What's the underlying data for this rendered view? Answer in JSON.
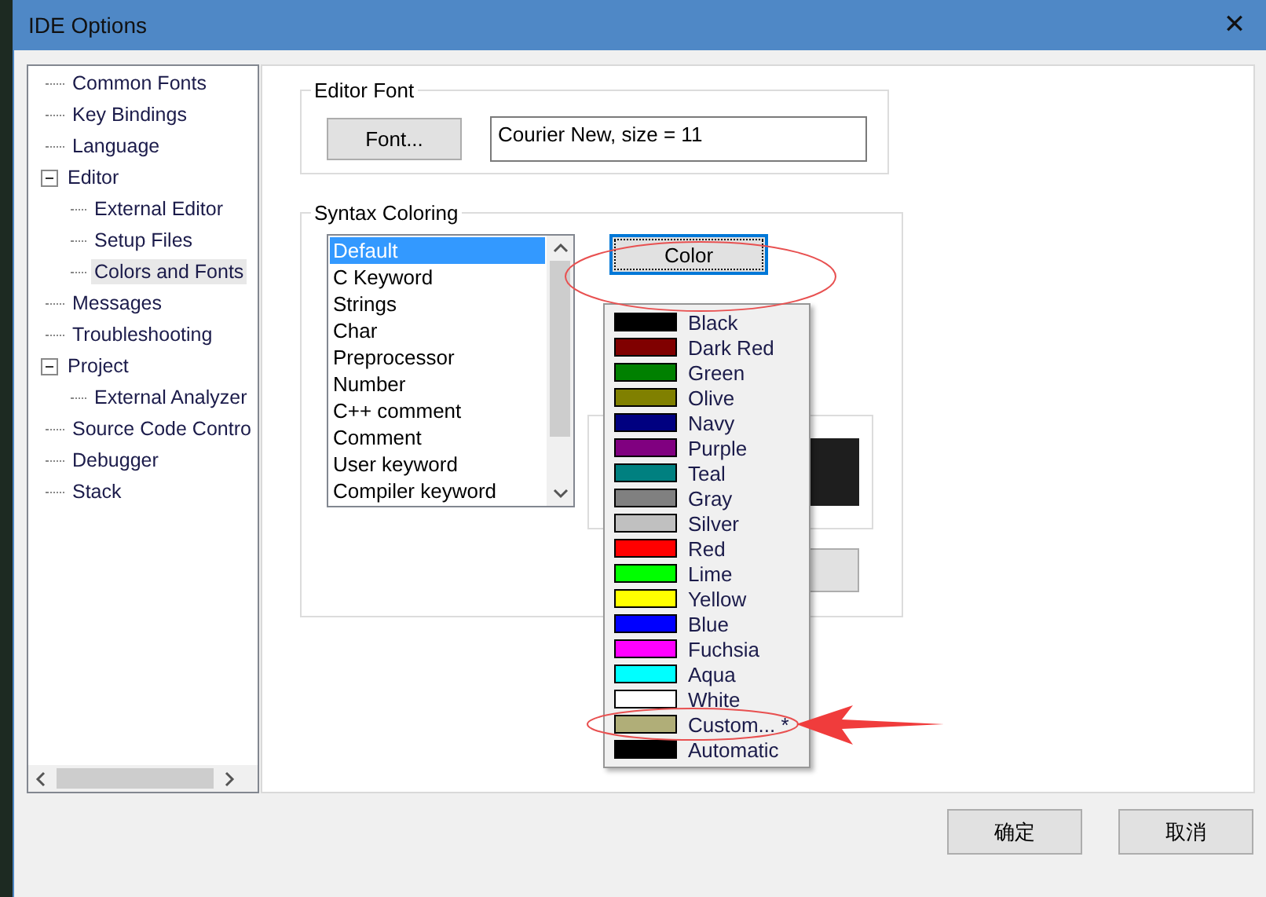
{
  "window": {
    "title": "IDE Options",
    "close": "✕"
  },
  "sidebar": {
    "items": [
      {
        "label": "Common Fonts",
        "selected": false
      },
      {
        "label": "Key Bindings",
        "selected": false
      },
      {
        "label": "Language",
        "selected": false
      },
      {
        "label": "Editor",
        "selected": false,
        "expanded": true,
        "children": [
          {
            "label": "External Editor",
            "selected": false
          },
          {
            "label": "Setup Files",
            "selected": false
          },
          {
            "label": "Colors and Fonts",
            "selected": true
          }
        ]
      },
      {
        "label": "Messages",
        "selected": false
      },
      {
        "label": "Troubleshooting",
        "selected": false
      },
      {
        "label": "Project",
        "selected": false,
        "expanded": true,
        "children": [
          {
            "label": "External Analyzer",
            "selected": false
          }
        ]
      },
      {
        "label": "Source Code Contro",
        "selected": false
      },
      {
        "label": "Debugger",
        "selected": false
      },
      {
        "label": "Stack",
        "selected": false
      }
    ]
  },
  "editor_font": {
    "title": "Editor Font",
    "button": "Font...",
    "value": "Courier New, size = 11"
  },
  "syntax_coloring": {
    "title": "Syntax Coloring",
    "items": [
      {
        "label": "Default",
        "selected": true
      },
      {
        "label": "C Keyword",
        "selected": false
      },
      {
        "label": "Strings",
        "selected": false
      },
      {
        "label": "Char",
        "selected": false
      },
      {
        "label": "Preprocessor",
        "selected": false
      },
      {
        "label": "Number",
        "selected": false
      },
      {
        "label": "C++ comment",
        "selected": false
      },
      {
        "label": "Comment",
        "selected": false
      },
      {
        "label": "User keyword",
        "selected": false
      },
      {
        "label": "Compiler keyword",
        "selected": false
      }
    ],
    "color_button": "Color"
  },
  "color_menu": [
    {
      "label": "Black",
      "color": "#000000"
    },
    {
      "label": "Dark Red",
      "color": "#800000"
    },
    {
      "label": "Green",
      "color": "#008000"
    },
    {
      "label": "Olive",
      "color": "#808000"
    },
    {
      "label": "Navy",
      "color": "#000080"
    },
    {
      "label": "Purple",
      "color": "#800080"
    },
    {
      "label": "Teal",
      "color": "#008080"
    },
    {
      "label": "Gray",
      "color": "#808080"
    },
    {
      "label": "Silver",
      "color": "#c0c0c0"
    },
    {
      "label": "Red",
      "color": "#ff0000"
    },
    {
      "label": "Lime",
      "color": "#00ff00"
    },
    {
      "label": "Yellow",
      "color": "#ffff00"
    },
    {
      "label": "Blue",
      "color": "#0000ff"
    },
    {
      "label": "Fuchsia",
      "color": "#ff00ff"
    },
    {
      "label": "Aqua",
      "color": "#00ffff"
    },
    {
      "label": "White",
      "color": "#ffffff"
    },
    {
      "label": "Custom... *",
      "color": "#b0ae78"
    },
    {
      "label": "Automatic",
      "color": "#000000"
    }
  ],
  "buttons": [
    "确定",
    "取消"
  ]
}
